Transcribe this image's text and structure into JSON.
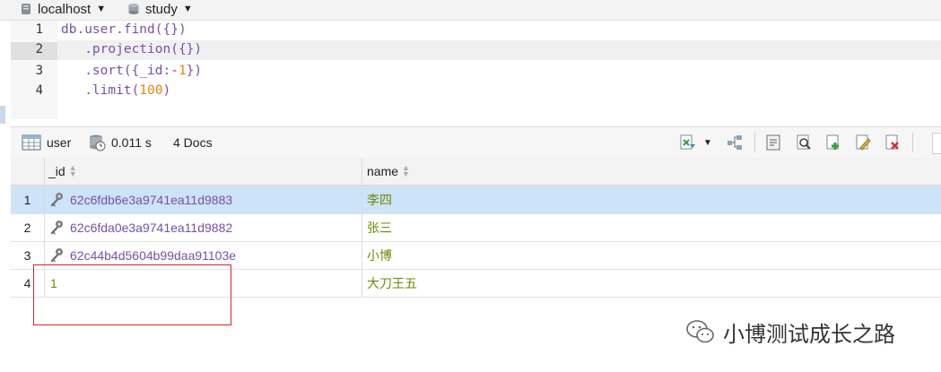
{
  "connection": {
    "server": "localhost",
    "database": "study"
  },
  "editor": {
    "lines": [
      {
        "no": "1",
        "text": "db.user.find({})"
      },
      {
        "no": "2",
        "text": "   .projection({})"
      },
      {
        "no": "3",
        "pre": "   .sort({_id:",
        "op": "-",
        "num": "1",
        "post": "})"
      },
      {
        "no": "4",
        "pre": "   .limit(",
        "num": "100",
        "post": ")"
      }
    ]
  },
  "toolbar": {
    "collection": "user",
    "time": "0.011 s",
    "docs": "4 Docs"
  },
  "grid": {
    "columns": [
      "_id",
      "name"
    ],
    "rows": [
      {
        "n": "1",
        "id": "62c6fdb6e3a9741ea11d9883",
        "name": "李四",
        "objectid": true
      },
      {
        "n": "2",
        "id": "62c6fda0e3a9741ea11d9882",
        "name": "张三",
        "objectid": true
      },
      {
        "n": "3",
        "id": "62c44b4d5604b99daa91103e",
        "name": "小博",
        "objectid": true
      },
      {
        "n": "4",
        "id": "1",
        "name": "大刀王五",
        "objectid": false
      }
    ]
  },
  "watermark": {
    "text": "小博测试成长之路"
  },
  "colors": {
    "selected_row": "#cde3f8",
    "objectid_text": "#7a4fa8",
    "value_text": "#6a8a00",
    "annotation_box": "#d9262b"
  }
}
